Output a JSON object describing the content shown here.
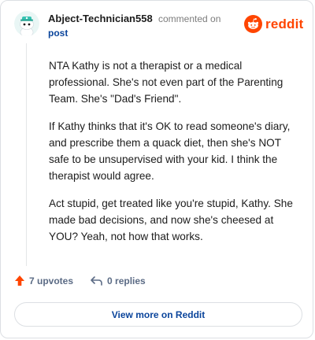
{
  "header": {
    "username": "Abject-Technician558",
    "action_text": "commented on",
    "post_link": "post",
    "logo_text": "reddit"
  },
  "comment": {
    "paragraphs": [
      "NTA Kathy is not a therapist or a medical professional. She's not even part of the Parenting Team. She's \"Dad's Friend\".",
      "If Kathy thinks that it's OK to read someone's diary, and prescribe them a quack diet, then she's NOT safe to be unsupervised with your kid. I think the therapist would agree.",
      "Act stupid, get treated like you're stupid, Kathy. She made bad decisions, and now she's cheesed at YOU? Yeah, not how that works."
    ]
  },
  "footer": {
    "upvotes_label": "7 upvotes",
    "replies_label": "0 replies",
    "view_more_label": "View more on Reddit"
  },
  "colors": {
    "brand": "#ff4500",
    "link": "#0a449b",
    "muted": "#5b6b85"
  },
  "icons": {
    "avatar": "snoo-avatar",
    "logo": "reddit-alien-icon",
    "upvote": "upvote-arrow-icon",
    "reply": "reply-arrow-icon"
  }
}
